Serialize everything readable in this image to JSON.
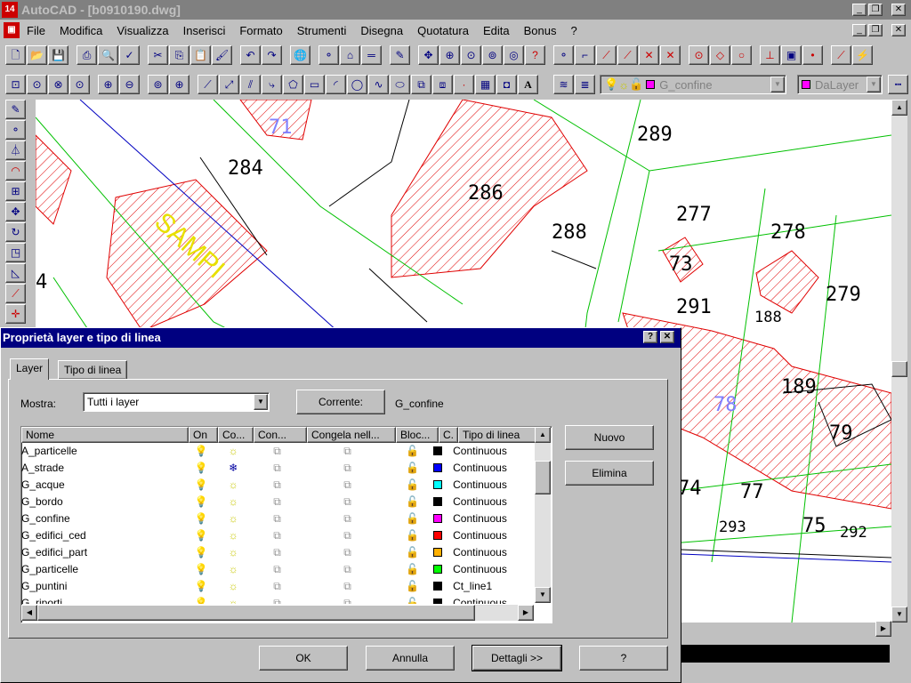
{
  "window": {
    "title": "AutoCAD - [b0910190.dwg]",
    "app_badge": "14"
  },
  "menu": [
    "File",
    "Modifica",
    "Visualizza",
    "Inserisci",
    "Formato",
    "Strumenti",
    "Disegna",
    "Quotatura",
    "Edita",
    "Bonus",
    "?"
  ],
  "toolbar": {
    "layer_combo": "G_confine",
    "color_combo": "DaLayer",
    "layer_color": "#ff00ff"
  },
  "drawing": {
    "labels": [
      "284",
      "286",
      "289",
      "288",
      "277",
      "278",
      "279",
      "73",
      "291",
      "188",
      "189",
      "79",
      "78",
      "77",
      "74",
      "75",
      "293",
      "292",
      "71",
      "4"
    ],
    "street": "SAMPI"
  },
  "dialog": {
    "title": "Proprietà layer e tipo di linea",
    "tabs": [
      "Layer",
      "Tipo di linea"
    ],
    "show_label": "Mostra:",
    "show_value": "Tutti i layer",
    "current_button": "Corrente:",
    "current_value": "G_confine",
    "columns": [
      "Nome",
      "On",
      "Co...",
      "Con...",
      "Congela nell...",
      "Bloc...",
      "C.",
      "Tipo di linea"
    ],
    "layers": [
      {
        "name": "A_particelle",
        "frozen": false,
        "color": "#000000",
        "linetype": "Continuous"
      },
      {
        "name": "A_strade",
        "frozen": true,
        "color": "#0000ff",
        "linetype": "Continuous"
      },
      {
        "name": "G_acque",
        "frozen": false,
        "color": "#00ffff",
        "linetype": "Continuous"
      },
      {
        "name": "G_bordo",
        "frozen": false,
        "color": "#000000",
        "linetype": "Continuous"
      },
      {
        "name": "G_confine",
        "frozen": false,
        "color": "#ff00ff",
        "linetype": "Continuous"
      },
      {
        "name": "G_edifici_ced",
        "frozen": false,
        "color": "#ff0000",
        "linetype": "Continuous"
      },
      {
        "name": "G_edifici_part",
        "frozen": false,
        "color": "#ffb000",
        "linetype": "Continuous"
      },
      {
        "name": "G_particelle",
        "frozen": false,
        "color": "#00ff00",
        "linetype": "Continuous"
      },
      {
        "name": "G_puntini",
        "frozen": false,
        "color": "#000000",
        "linetype": "Ct_line1"
      },
      {
        "name": "G_riporti",
        "frozen": false,
        "color": "#000000",
        "linetype": "Continuous"
      }
    ],
    "buttons": {
      "new": "Nuovo",
      "delete": "Elimina",
      "ok": "OK",
      "cancel": "Annulla",
      "details": "Dettagli >>",
      "help": "?"
    }
  }
}
